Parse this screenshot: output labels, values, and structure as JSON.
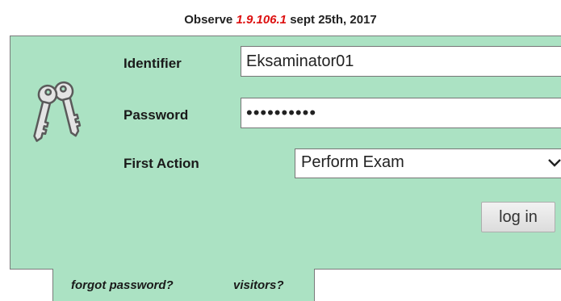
{
  "header": {
    "app_name": "Observe",
    "version": "1.9.106.1",
    "release_date": "sept 25th, 2017"
  },
  "login": {
    "identifier_label": "Identifier",
    "identifier_value": "Eksaminator01",
    "password_label": "Password",
    "password_value": "••••••••••",
    "first_action_label": "First Action",
    "first_action_value": "Perform Exam",
    "login_button_label": "log in"
  },
  "links": {
    "forgot_password": "forgot password?",
    "visitors": "visitors?"
  },
  "icons": {
    "keys": "keys-icon",
    "dropdown": "chevron-down-icon"
  },
  "colors": {
    "panel_background": "#abe2c3",
    "version_accent": "#dd1111"
  }
}
